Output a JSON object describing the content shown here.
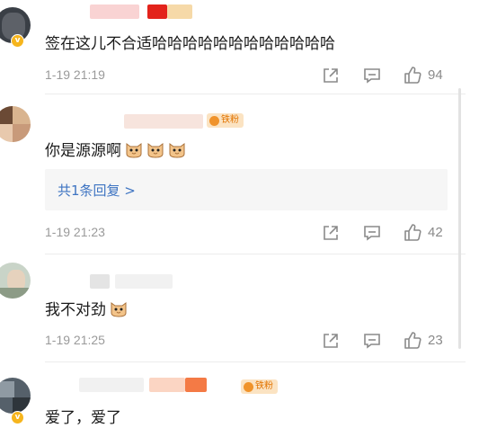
{
  "comments": [
    {
      "text": "签在这儿不合适哈哈哈哈哈哈哈哈哈哈哈哈",
      "time": "1-19 21:19",
      "likes": "94"
    },
    {
      "badge": "铁粉",
      "text": "你是源源啊",
      "time": "1-19 21:23",
      "likes": "42",
      "replies_label": "共1条回复 >"
    },
    {
      "text": "我不对劲",
      "time": "1-19 21:25",
      "likes": "23"
    },
    {
      "badge": "铁粉",
      "text": "爱了，爱了"
    }
  ],
  "colors": {
    "link": "#3e74c2",
    "fan_badge_bg": "#fbe3c2",
    "fan_badge_text": "#e27400",
    "meta_text": "#9a9a9a"
  },
  "icons": {
    "share": "share-icon",
    "comment": "comment-icon",
    "like": "thumbs-up-icon",
    "emoji": "cat-face-emoji"
  }
}
